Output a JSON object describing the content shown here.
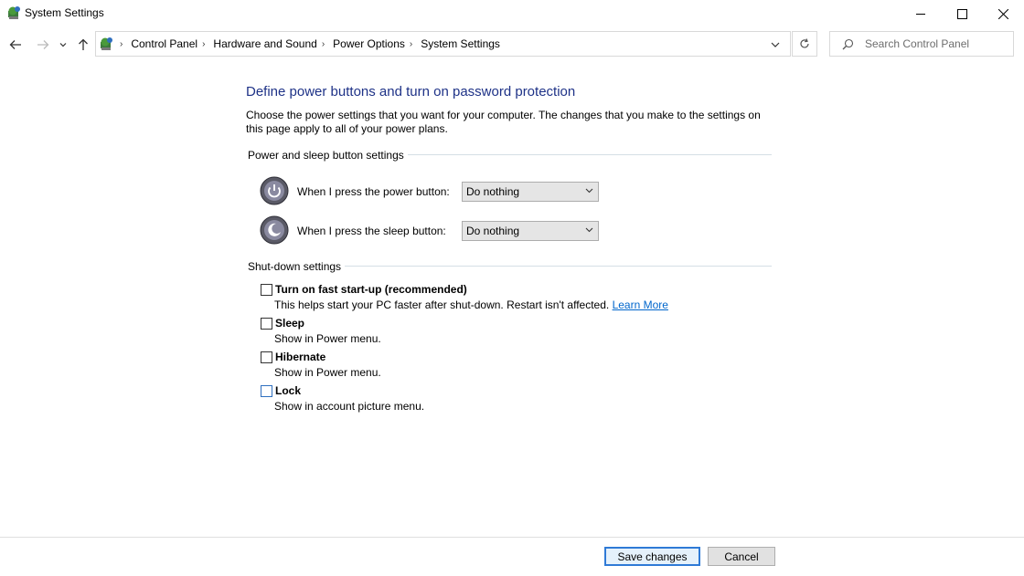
{
  "window": {
    "title": "System Settings",
    "controls": {
      "minimize": "minimize-icon",
      "maximize": "maximize-icon",
      "close": "close-icon"
    }
  },
  "nav": {
    "back_icon": "arrow-left-icon",
    "forward_icon": "arrow-right-icon",
    "recent_icon": "chevron-down-icon",
    "up_icon": "arrow-up-icon"
  },
  "address": {
    "crumbs": [
      "Control Panel",
      "Hardware and Sound",
      "Power Options",
      "System Settings"
    ]
  },
  "search": {
    "placeholder": "Search Control Panel"
  },
  "content": {
    "heading": "Define power buttons and turn on password protection",
    "description": "Choose the power settings that you want for your computer. The changes that you make to the settings on this page apply to all of your power plans.",
    "power_section": {
      "title": "Power and sleep button settings",
      "power_label": "When I press the power button:",
      "power_value": "Do nothing",
      "sleep_label": "When I press the sleep button:",
      "sleep_value": "Do nothing"
    },
    "shutdown_section": {
      "title": "Shut-down settings",
      "items": [
        {
          "label": "Turn on fast start-up (recommended)",
          "desc": "This helps start your PC faster after shut-down. Restart isn't affected.",
          "link": "Learn More",
          "checked": false
        },
        {
          "label": "Sleep",
          "desc": "Show in Power menu.",
          "checked": false
        },
        {
          "label": "Hibernate",
          "desc": "Show in Power menu.",
          "checked": false
        },
        {
          "label": "Lock",
          "desc": "Show in account picture menu.",
          "checked": false
        }
      ]
    }
  },
  "footer": {
    "save_label": "Save changes",
    "cancel_label": "Cancel"
  },
  "colors": {
    "heading": "#1e3287",
    "link": "#0066cc",
    "primary_border": "#2f7ad6"
  }
}
